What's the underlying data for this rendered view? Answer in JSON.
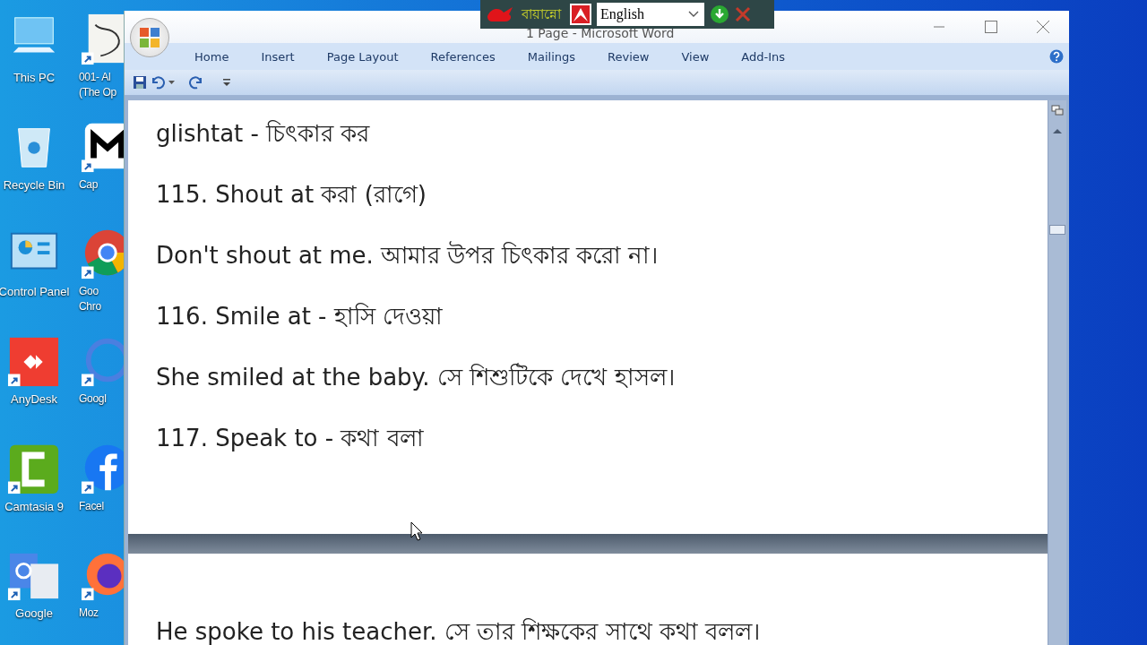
{
  "desktop": {
    "columns": [
      {
        "icons": [
          {
            "kind": "pc",
            "lines": [
              "This PC"
            ]
          },
          {
            "kind": "recycle",
            "lines": [
              "Recycle Bin"
            ]
          },
          {
            "kind": "control",
            "lines": [
              "Control Panel"
            ]
          },
          {
            "kind": "anydesk",
            "lines": [
              "AnyDesk"
            ]
          },
          {
            "kind": "camtasia",
            "lines": [
              "Camtasia 9"
            ]
          },
          {
            "kind": "translate",
            "lines": [
              "Google"
            ]
          }
        ]
      },
      {
        "icons": [
          {
            "kind": "thumb",
            "lines": [
              "001- Al",
              "(The Op"
            ]
          },
          {
            "kind": "capcut",
            "lines": [
              "Cap"
            ]
          },
          {
            "kind": "chrome",
            "lines": [
              "Goo",
              "Chro"
            ]
          },
          {
            "kind": "gblue",
            "lines": [
              "Googl"
            ]
          },
          {
            "kind": "facebook",
            "lines": [
              "Facel"
            ]
          },
          {
            "kind": "firefox",
            "lines": [
              "Moz"
            ]
          }
        ]
      }
    ]
  },
  "window": {
    "title": "1 Page - Microsoft Word",
    "tabs": [
      {
        "label": "Home",
        "selected": false
      },
      {
        "label": "Insert",
        "selected": false
      },
      {
        "label": "Page Layout",
        "selected": false
      },
      {
        "label": "References",
        "selected": false
      },
      {
        "label": "Mailings",
        "selected": false
      },
      {
        "label": "Review",
        "selected": false
      },
      {
        "label": "View",
        "selected": false
      },
      {
        "label": "Add-Ins",
        "selected": false
      }
    ]
  },
  "keyboard_bar": {
    "name": "বায়ান্নো",
    "language": "English"
  },
  "document": {
    "pages": [
      {
        "lines": [
          "glishtat - চিৎকার কর",
          "115. Shout at করা (রাগে)",
          "Don't shout at me. আমার উপর চিৎকার করো না।",
          "116. Smile at - হাসি দেওয়া",
          "She smiled at the baby. সে শিশুটিকে দেখে হাসল।",
          "117. Speak to - কথা বলা"
        ]
      },
      {
        "lines": [
          "He spoke to his teacher. সে তার শিক্ষকের সাথে কথা বলল।"
        ]
      }
    ]
  }
}
